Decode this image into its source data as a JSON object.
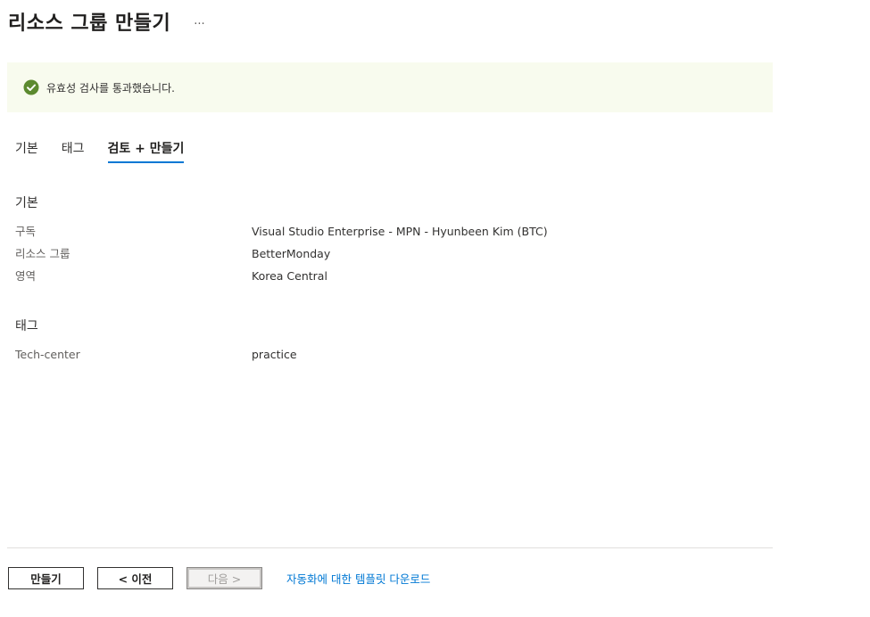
{
  "page": {
    "title": "리소스 그룹 만들기",
    "more_label": "..."
  },
  "validation": {
    "message": "유효성 검사를 통과했습니다.",
    "status_color": "#5c8a2f"
  },
  "tabs": [
    {
      "label": "기본",
      "active": false
    },
    {
      "label": "태그",
      "active": false
    },
    {
      "label": "검토 + 만들기",
      "active": true
    }
  ],
  "basics": {
    "heading": "기본",
    "rows": [
      {
        "label": "구독",
        "value": "Visual Studio Enterprise - MPN - Hyunbeen Kim (BTC)"
      },
      {
        "label": "리소스 그룹",
        "value": "BetterMonday"
      },
      {
        "label": "영역",
        "value": "Korea Central"
      }
    ]
  },
  "tags": {
    "heading": "태그",
    "rows": [
      {
        "label": "Tech-center",
        "value": "practice"
      }
    ]
  },
  "footer": {
    "create_label": "만들기",
    "prev_label": "< 이전",
    "next_label": "다음 >",
    "download_link": "자동화에 대한 템플릿 다운로드"
  },
  "colors": {
    "accent": "#0078d4",
    "banner_background": "#f8fbee",
    "success": "#5c8a2f"
  }
}
